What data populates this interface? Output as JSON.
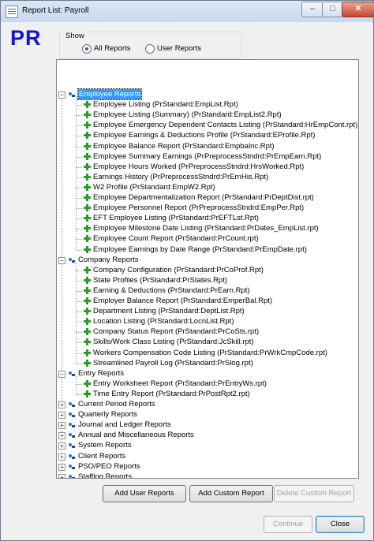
{
  "window": {
    "title": "Report List: Payroll",
    "min_glyph": "–",
    "max_glyph": "□",
    "close_glyph": "✕"
  },
  "logo": "PR",
  "show": {
    "label": "Show",
    "options": [
      "All Reports",
      "User Reports"
    ],
    "selected": "All Reports"
  },
  "tree": [
    {
      "label": "Employee Reports",
      "expanded": true,
      "selected": true,
      "children": [
        "Employee Listing  (PrStandard:EmpList.Rpt)",
        "Employee Listing  (Summary)  (PrStandard:EmpList2.Rpt)",
        "Employee Emergency Dependent Contacts Listing  (PrStandard:HrEmpCont.rpt)",
        "Employee Earnings & Deductions Profile  (PrStandard:EProfile.Rpt)",
        "Employee Balance Report  (PrStandard:Empbalnc.Rpt)",
        "Employee Summary Earnings  (PrPreprocessStndrd:PrEmpEarn.Rpt)",
        "Employee Hours Worked  (PrPreprocessStndrd:HrsWorked.Rpt)",
        "Earnings History  (PrPreprocessStndrd:PrErnHis.Rpt)",
        "W2 Profile  (PrStandard:EmpW2.Rpt)",
        "Employee Departmentalization Report  (PrStandard:PrDeptDist.rpt)",
        "Employee Personnel Report  (PrPreprocessStndrd:EmpPer.Rpt)",
        "EFT Employee Listing  (PrStandard:PrEFTLst.Rpt)",
        "Employee Milestone Date Listing  (PrStandard:PrDates_EmpList.rpt)",
        "Employee Count Report  (PrStandard:PrCount.rpt)",
        "Employee Earnings by Date Range  (PrStandard:PrEmpDate.rpt)"
      ]
    },
    {
      "label": "Company Reports",
      "expanded": true,
      "children": [
        "Company Configuration  (PrStandard:PrCoProf.Rpt)",
        "State Profiles  (PrStandard:PrStates.Rpt)",
        "Earning & Deductions  (PrStandard:PrEarn.Rpt)",
        "Employer Balance Report  (PrStandard:EmperBal.Rpt)",
        "Department Listing  (PrStandard:DeptList.Rpt)",
        "Location Listing  (PrStandard:LocnList.Rpt)",
        "Company Status Report  (PrStandard:PrCoSts.rpt)",
        "Skills/Work Class Listing  (PrStandard:JcSkill.rpt)",
        "Workers Compensation Code Listing  (PrStandard:PrWrkCmpCode.rpt)",
        "Streamlined Payroll Log  (PrStandard:PrSlog.rpt)"
      ]
    },
    {
      "label": "Entry Reports",
      "expanded": true,
      "children": [
        "Entry Worksheet Report  (PrStandard:PrEntryWs.rpt)",
        "Time Entry Report  (PrStandard:PrPostRpt2.rpt)"
      ]
    },
    {
      "label": "Current Period Reports",
      "expanded": false,
      "children": []
    },
    {
      "label": "Quarterly Reports",
      "expanded": false,
      "children": []
    },
    {
      "label": "Journal and Ledger Reports",
      "expanded": false,
      "children": []
    },
    {
      "label": "Annual and Miscellaneous Reports",
      "expanded": false,
      "children": []
    },
    {
      "label": "System Reports",
      "expanded": false,
      "children": []
    },
    {
      "label": "Client Reports",
      "expanded": false,
      "children": []
    },
    {
      "label": "PSO/PEO Reports",
      "expanded": false,
      "children": []
    },
    {
      "label": "Staffing Reports",
      "expanded": false,
      "children": []
    }
  ],
  "buttons": {
    "add_user": "Add User Reports",
    "add_custom": "Add Custom Report",
    "delete_custom": "Delete Custom Report",
    "continue": "Continue",
    "close": "Close"
  }
}
